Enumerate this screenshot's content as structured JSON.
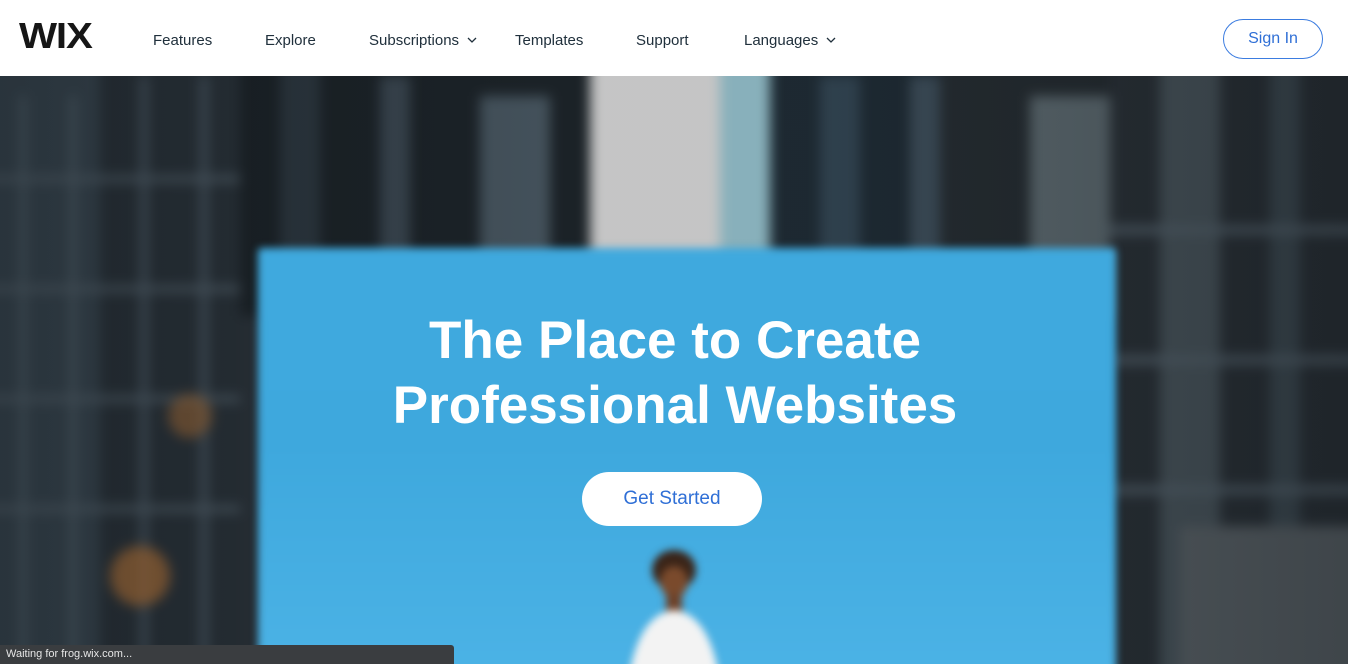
{
  "header": {
    "logo_text": "WIX",
    "nav": [
      {
        "label": "Features"
      },
      {
        "label": "Explore"
      },
      {
        "label": "Subscriptions",
        "has_dropdown": true
      },
      {
        "label": "Templates"
      },
      {
        "label": "Support"
      },
      {
        "label": "Languages",
        "has_dropdown": true
      }
    ],
    "sign_in_label": "Sign In"
  },
  "hero": {
    "headline_line1": "The Place to Create",
    "headline_line2": "Professional Websites",
    "cta_label": "Get Started"
  },
  "status_bar": {
    "text": "Waiting for frog.wix.com..."
  },
  "colors": {
    "accent": "#2f6fd6",
    "hero_blue": "#3fa9de",
    "nav_text": "#20303c",
    "status_bg": "#3a3d40"
  },
  "icons": [
    "chevron-down-icon"
  ]
}
